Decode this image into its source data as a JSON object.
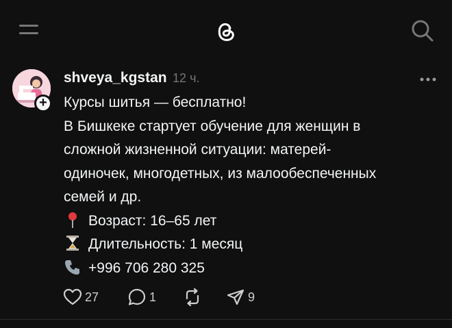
{
  "post": {
    "username": "shveya_kgstan",
    "time": "12 ч.",
    "lines": [
      "Курсы шитья — бесплатно!",
      "В Бишкеке стартует обучение для женщин в",
      "сложной жизненной ситуации: матерей-",
      "одиночек, многодетных, из малообеспеченных",
      "семей и др."
    ],
    "details": [
      {
        "icon": "pin-icon",
        "text": "Возраст: 16–65 лет"
      },
      {
        "icon": "hourglass-icon",
        "text": "Длительность: 1 месяц"
      },
      {
        "icon": "phone-icon",
        "text": "+996 706 280 325"
      }
    ],
    "likes": "27",
    "comments": "1",
    "shares": "9"
  },
  "colors": {
    "background": "#101010",
    "text": "#f3f5f7",
    "muted": "#777777"
  }
}
